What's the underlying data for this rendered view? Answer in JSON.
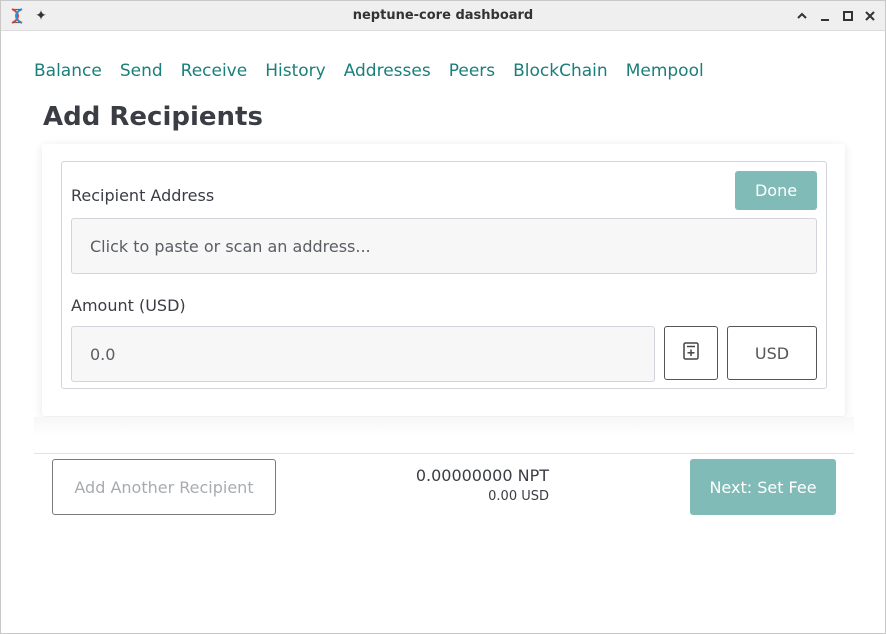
{
  "window": {
    "title": "neptune-core dashboard",
    "pin_glyph": "✦",
    "app_icon": "dna-helix-icon"
  },
  "nav": {
    "items": [
      "Balance",
      "Send",
      "Receive",
      "History",
      "Addresses",
      "Peers",
      "BlockChain",
      "Mempool"
    ]
  },
  "page": {
    "title": "Add Recipients"
  },
  "recipient": {
    "address_label": "Recipient Address",
    "done_label": "Done",
    "address_placeholder": "Click to paste or scan an address...",
    "amount_label": "Amount (USD)",
    "amount_value": "0.0",
    "currency_label": "USD"
  },
  "footer": {
    "add_another_label": "Add Another Recipient",
    "total_npt": "0.00000000 NPT",
    "total_usd": "0.00 USD",
    "next_label": "Next: Set Fee"
  },
  "colors": {
    "accent": "#1a7f7a",
    "button": "#80bbb8",
    "text": "#3a3d44"
  }
}
